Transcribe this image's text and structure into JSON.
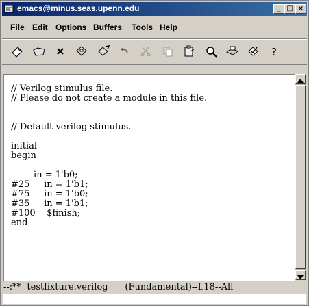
{
  "window": {
    "title": "emacs@minus.seas.upenn.edu",
    "minimize_label": "_",
    "maximize_label": "□",
    "close_label": "×"
  },
  "menu": {
    "items": [
      {
        "label": "File"
      },
      {
        "label": "Edit"
      },
      {
        "label": "Options"
      },
      {
        "label": "Buffers"
      },
      {
        "label": "Tools"
      },
      {
        "label": "Help"
      }
    ]
  },
  "toolbar": {
    "buttons": [
      {
        "icon": "new-file-icon"
      },
      {
        "icon": "open-folder-icon"
      },
      {
        "icon": "close-x-icon"
      },
      {
        "icon": "save-disk-icon"
      },
      {
        "icon": "save-as-icon"
      },
      {
        "icon": "undo-icon"
      },
      {
        "icon": "cut-icon"
      },
      {
        "icon": "copy-icon"
      },
      {
        "icon": "paste-icon"
      },
      {
        "icon": "search-icon"
      },
      {
        "icon": "print-icon"
      },
      {
        "icon": "preferences-icon"
      },
      {
        "icon": "help-icon"
      }
    ]
  },
  "editor": {
    "lines": [
      "// Verilog stimulus file.",
      "// Please do not create a module in this file.",
      "",
      "",
      "// Default verilog stimulus.",
      "",
      "initial",
      "begin",
      "",
      "        in = 1'b0;",
      "#25     in = 1'b1;",
      "#75     in = 1'b0;",
      "#35     in = 1'b1;",
      "#100    $finish;",
      "end"
    ]
  },
  "modeline": {
    "text": "--:**  testfixture.verilog      (Fundamental)--L18--All"
  },
  "colors": {
    "titlebar_start": "#0a246a",
    "titlebar_end": "#3a6ea5",
    "chrome": "#d4d0c8",
    "editor_bg": "#ffffff"
  }
}
